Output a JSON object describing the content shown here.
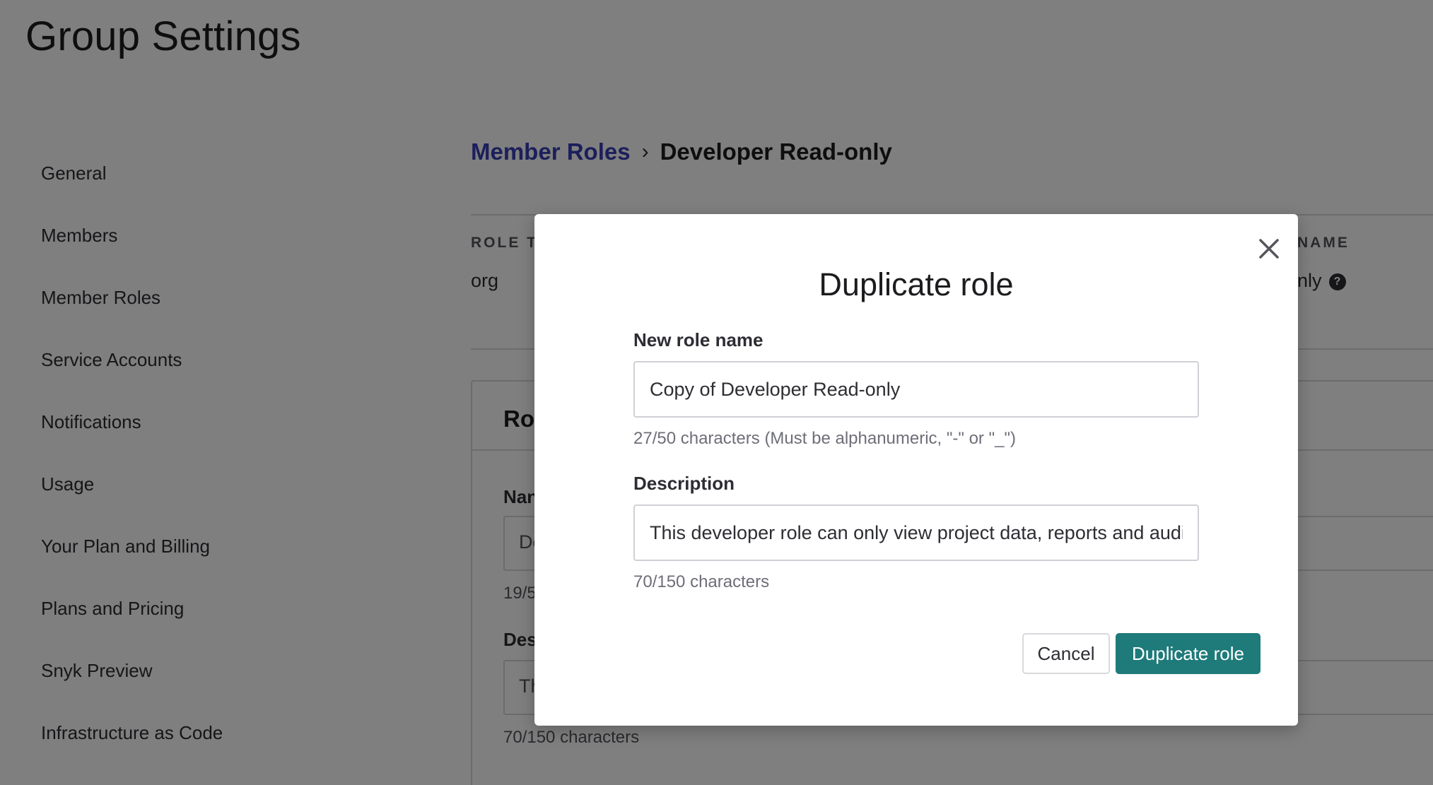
{
  "page": {
    "title": "Group Settings"
  },
  "sidebar": {
    "items": [
      {
        "label": "General"
      },
      {
        "label": "Members"
      },
      {
        "label": "Member Roles"
      },
      {
        "label": "Service Accounts"
      },
      {
        "label": "Notifications"
      },
      {
        "label": "Usage"
      },
      {
        "label": "Your Plan and Billing"
      },
      {
        "label": "Plans and Pricing"
      },
      {
        "label": "Snyk Preview"
      },
      {
        "label": "Infrastructure as Code"
      }
    ]
  },
  "breadcrumb": {
    "parent": "Member Roles",
    "separator": "›",
    "current": "Developer Read-only"
  },
  "role_meta": {
    "type_label": "ROLE TY",
    "type_value": "org",
    "name_label": "NAME",
    "name_value": "only"
  },
  "role_panel": {
    "title": "Rol",
    "name_label": "Nan",
    "name_value": "De",
    "name_hint": "19/5",
    "desc_label": "Des",
    "desc_value": "Th",
    "desc_hint": "70/150 characters"
  },
  "modal": {
    "title": "Duplicate role",
    "name_field": {
      "label": "New role name",
      "value": "Copy of Developer Read-only",
      "hint": "27/50 characters (Must be alphanumeric, \"-\" or \"_\")"
    },
    "description_field": {
      "label": "Description",
      "value": "This developer role can only view project data, reports and audit logs.",
      "hint": "70/150 characters"
    },
    "cancel_label": "Cancel",
    "confirm_label": "Duplicate role",
    "close_icon": "close-icon"
  },
  "colors": {
    "link": "#383eb6",
    "primary_button": "#1f7a7a",
    "overlay": "rgba(0,0,0,0.5)"
  }
}
